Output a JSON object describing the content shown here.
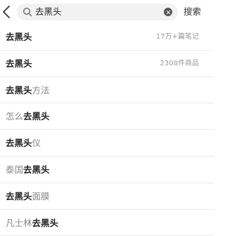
{
  "header": {
    "back_icon": "chevron-left-icon",
    "search_icon": "search-icon",
    "query": "去黑头",
    "clear_icon": "clear-circle-icon",
    "search_button": "搜索"
  },
  "suggestions": [
    {
      "prefix": "",
      "highlight": "去黑头",
      "suffix": "",
      "meta": "17万+篇笔记"
    },
    {
      "prefix": "",
      "highlight": "去黑头",
      "suffix": "",
      "meta": "2308件商品"
    },
    {
      "prefix": "",
      "highlight": "去黑头",
      "suffix": "方法",
      "meta": ""
    },
    {
      "prefix": "怎么",
      "highlight": "去黑头",
      "suffix": "",
      "meta": ""
    },
    {
      "prefix": "",
      "highlight": "去黑头",
      "suffix": "仪",
      "meta": ""
    },
    {
      "prefix": "泰国",
      "highlight": "去黑头",
      "suffix": "",
      "meta": ""
    },
    {
      "prefix": "",
      "highlight": "去黑头",
      "suffix": "面膜",
      "meta": ""
    },
    {
      "prefix": "凡士林",
      "highlight": "去黑头",
      "suffix": "",
      "meta": ""
    }
  ],
  "colors": {
    "highlight_text": "#222222",
    "plain_text": "#888888",
    "meta_text": "#999999",
    "search_bg": "#f2f2f2",
    "divider": "#ececec"
  }
}
